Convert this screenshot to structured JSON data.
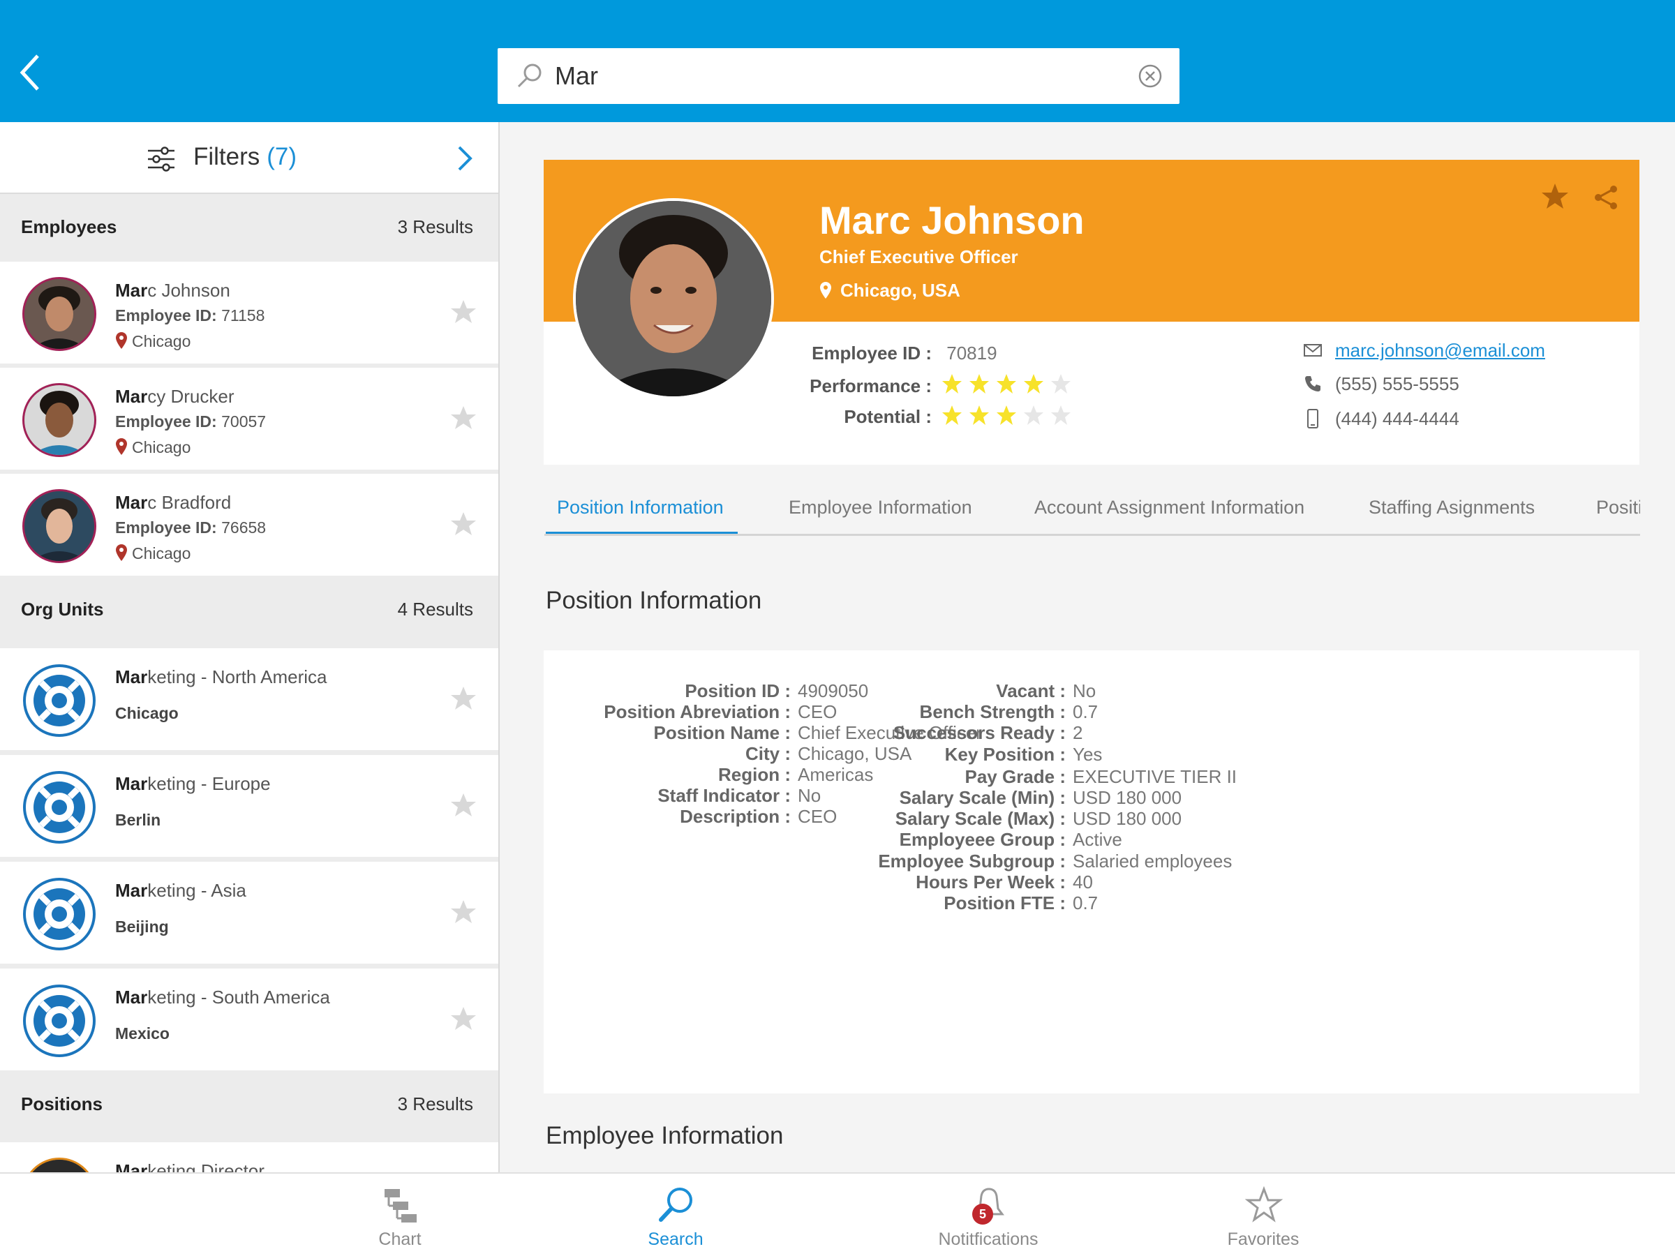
{
  "search": {
    "value": "Mar"
  },
  "filters": {
    "label": "Filters",
    "count": "(7)"
  },
  "employees_section": {
    "title": "Employees",
    "count": "3 Results",
    "items": [
      {
        "match": "Mar",
        "rest": "c Johnson",
        "id_label": "Employee ID:",
        "id": " 71158",
        "location": "Chicago"
      },
      {
        "match": "Mar",
        "rest": "cy Drucker",
        "id_label": "Employee ID:",
        "id": " 70057",
        "location": "Chicago"
      },
      {
        "match": "Mar",
        "rest": "c Bradford",
        "id_label": "Employee ID:",
        "id": " 76658",
        "location": "Chicago"
      }
    ]
  },
  "org_section": {
    "title": "Org Units",
    "count": "4 Results",
    "items": [
      {
        "match": "Mar",
        "rest": "keting - North America",
        "location": "Chicago"
      },
      {
        "match": "Mar",
        "rest": "keting - Europe",
        "location": "Berlin"
      },
      {
        "match": "Mar",
        "rest": "keting - Asia",
        "location": "Beijing"
      },
      {
        "match": "Mar",
        "rest": "keting - South America",
        "location": "Mexico"
      }
    ]
  },
  "positions_section": {
    "title": "Positions",
    "count": "3 Results",
    "items": [
      {
        "match": "Mar",
        "rest": "keting Director"
      }
    ]
  },
  "profile": {
    "name": "Marc Johnson",
    "title": "Chief Executive Officer",
    "location": "Chicago, USA",
    "employee_id_label": "Employee ID :",
    "employee_id": "70819",
    "performance_label": "Performance :",
    "performance": 4,
    "potential_label": "Potential :",
    "potential": 3,
    "stars_max": 5,
    "email": "marc.johnson@email.com",
    "phone": "(555) 555-5555",
    "mobile": "(444) 444-4444",
    "banner_color": "#f49a1e"
  },
  "tabs": [
    "Position Information",
    "Employee Information",
    "Account Assignment Information",
    "Staffing Asignments",
    "Position F"
  ],
  "position_info": {
    "title": "Position Information",
    "left": [
      {
        "label": "Position ID :",
        "value": "4909050"
      },
      {
        "label": "Position Abreviation :",
        "value": "CEO"
      },
      {
        "label": "Position Name :",
        "value": "Chief Executive Officer"
      },
      {
        "label": "City :",
        "value": "Chicago, USA"
      },
      {
        "label": "Region :",
        "value": "Americas"
      },
      {
        "label": "Staff Indicator :",
        "value": "No"
      },
      {
        "label": "Description :",
        "value": "CEO"
      }
    ],
    "right": [
      {
        "label": "Vacant :",
        "value": "No"
      },
      {
        "label": "Bench Strength :",
        "value": "0.7"
      },
      {
        "label": "Successors Ready :",
        "value": "2"
      },
      {
        "label": "Key Position :",
        "value": "Yes"
      },
      {
        "label": "Pay Grade :",
        "value": "EXECUTIVE TIER II"
      },
      {
        "label": "Salary Scale (Min) :",
        "value": "USD 180 000"
      },
      {
        "label": "Salary Scale (Max) :",
        "value": "USD 180 000"
      },
      {
        "label": "Employeee Group :",
        "value": "Active"
      },
      {
        "label": "Employee Subgroup :",
        "value": "Salaried employees"
      },
      {
        "label": "Hours Per Week :",
        "value": "40"
      },
      {
        "label": "Position FTE :",
        "value": "0.7"
      }
    ]
  },
  "employee_info": {
    "title": "Employee Information"
  },
  "bottom_nav": {
    "chart": "Chart",
    "search": "Search",
    "notifications": "Notitfications",
    "notifications_badge": "5",
    "favorites": "Favorites"
  },
  "colors": {
    "primary": "#0099dc",
    "accent": "#1b8fd6",
    "banner": "#f49a1e",
    "star_on": "#f7e22a"
  }
}
